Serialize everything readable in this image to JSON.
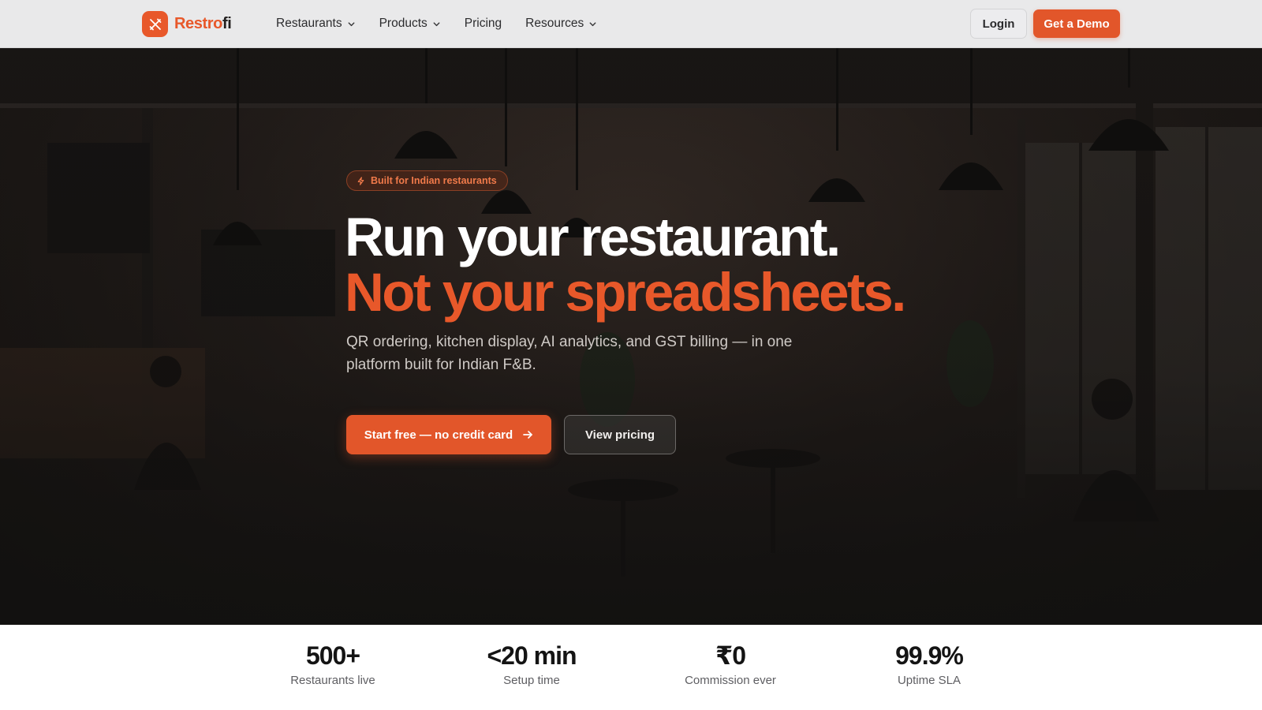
{
  "brand": {
    "name_part1": "Restro",
    "name_part2": "fi",
    "accent": "#e8582a",
    "logo_icon": "fork-knife-cross-icon"
  },
  "nav": {
    "items": [
      {
        "label": "Restaurants",
        "has_dropdown": true
      },
      {
        "label": "Products",
        "has_dropdown": true
      },
      {
        "label": "Pricing",
        "has_dropdown": false
      },
      {
        "label": "Resources",
        "has_dropdown": true
      }
    ],
    "login_label": "Login",
    "demo_label": "Get a Demo"
  },
  "hero": {
    "badge": "Built for Indian restaurants",
    "badge_icon": "lightning-bolt-icon",
    "headline_line1": "Run your restaurant.",
    "headline_line2": "Not your spreadsheets.",
    "subtext": "QR ordering, kitchen display, AI analytics, and GST billing — in one platform built for Indian F&B.",
    "primary_cta": "Start free — no credit card",
    "primary_cta_icon": "arrow-right-icon",
    "secondary_cta": "View pricing"
  },
  "stats": [
    {
      "value": "500+",
      "label": "Restaurants live"
    },
    {
      "value": "<20 min",
      "label": "Setup time"
    },
    {
      "value": "₹0",
      "label": "Commission ever"
    },
    {
      "value": "99.9%",
      "label": "Uptime SLA"
    }
  ]
}
